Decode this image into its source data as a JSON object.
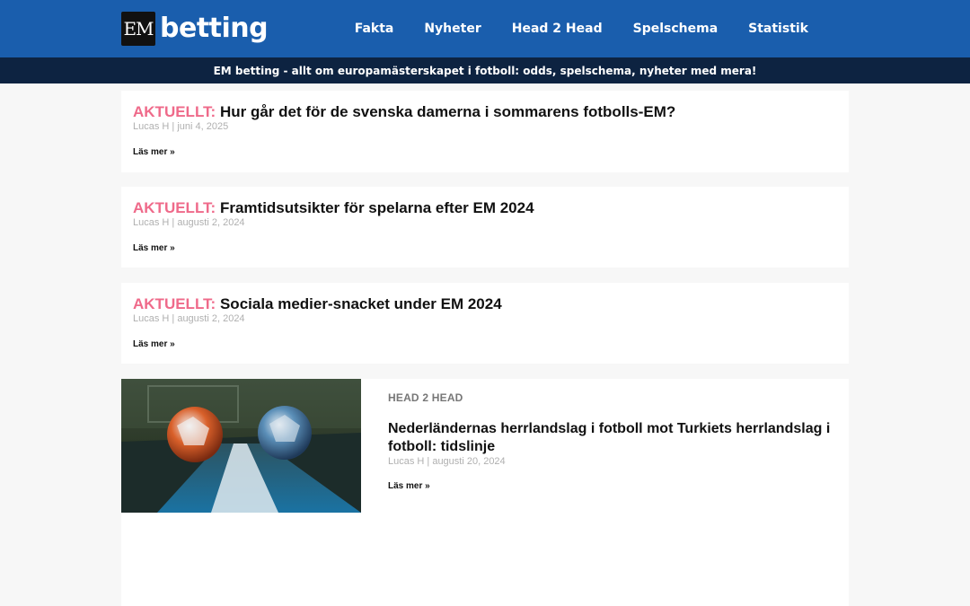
{
  "header": {
    "logo_badge": "EM",
    "logo_text": "betting",
    "nav": [
      "Fakta",
      "Nyheter",
      "Head 2 Head",
      "Spelschema",
      "Statistik"
    ],
    "tagline": "EM betting - allt om europamästerskapet i fotboll: odds, spelschema, nyheter med mera!"
  },
  "posts": [
    {
      "tag": "AKTUELLT:",
      "title": "Hur går det för de svenska damerna i sommarens fotbolls-EM?",
      "meta": "Lucas H | juni 4, 2025",
      "more": "Läs mer »"
    },
    {
      "tag": "AKTUELLT:",
      "title": "Framtidsutsikter för spelarna efter EM 2024",
      "meta": "Lucas H | augusti 2, 2024",
      "more": "Läs mer »"
    },
    {
      "tag": "AKTUELLT:",
      "title": "Sociala medier-snacket under EM 2024",
      "meta": "Lucas H | augusti 2, 2024",
      "more": "Läs mer »"
    }
  ],
  "feature": {
    "category": "HEAD 2 HEAD",
    "title": "Nederländernas herrlandslag i fotboll mot Turkiets herrlandslag i fotboll: tidslinje",
    "meta": "Lucas H | augusti 20, 2024",
    "more": "Läs mer »",
    "image_icon": "two-footballs-on-pitch-image"
  },
  "colors": {
    "header_bg": "#1a5ead",
    "tagline_bg": "#0d2341",
    "tag_pink": "#ef6a8a",
    "meta_grey": "#b0b0b0"
  }
}
